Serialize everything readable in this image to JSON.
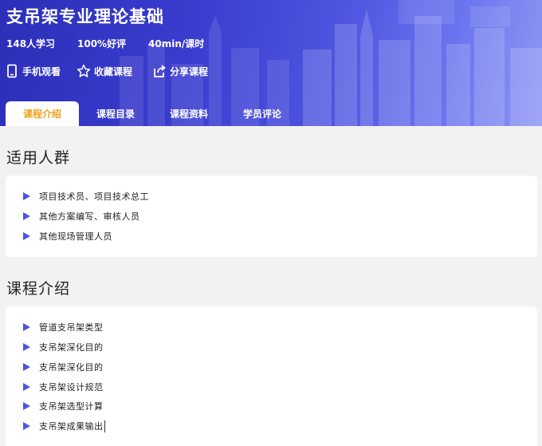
{
  "header": {
    "title": "支吊架专业理论基础",
    "stats": [
      "148人学习",
      "100%好评",
      "40min/课时"
    ],
    "actions": [
      {
        "icon": "phone-icon",
        "label": "手机观看"
      },
      {
        "icon": "star-icon",
        "label": "收藏课程"
      },
      {
        "icon": "share-icon",
        "label": "分享课程"
      }
    ],
    "tabs": [
      "课程介绍",
      "课程目录",
      "课程资料",
      "学员评论"
    ],
    "active_tab": "课程介绍"
  },
  "audience": {
    "title": "适用人群",
    "items": [
      "项目技术员、项目技术总工",
      "其他方案编写、审核人员",
      "其他现场管理人员"
    ]
  },
  "intro": {
    "title": "课程介绍",
    "items": [
      "管道支吊架类型",
      "支吊架深化目的",
      "支吊架深化目的",
      "支吊架设计规范",
      "支吊架选型计算",
      "支吊架成果输出"
    ]
  },
  "colors": {
    "accent": "#f0a21a",
    "bullet": "#4a55e8",
    "hero_start": "#2c2fb8",
    "hero_end": "#8e96f3"
  }
}
